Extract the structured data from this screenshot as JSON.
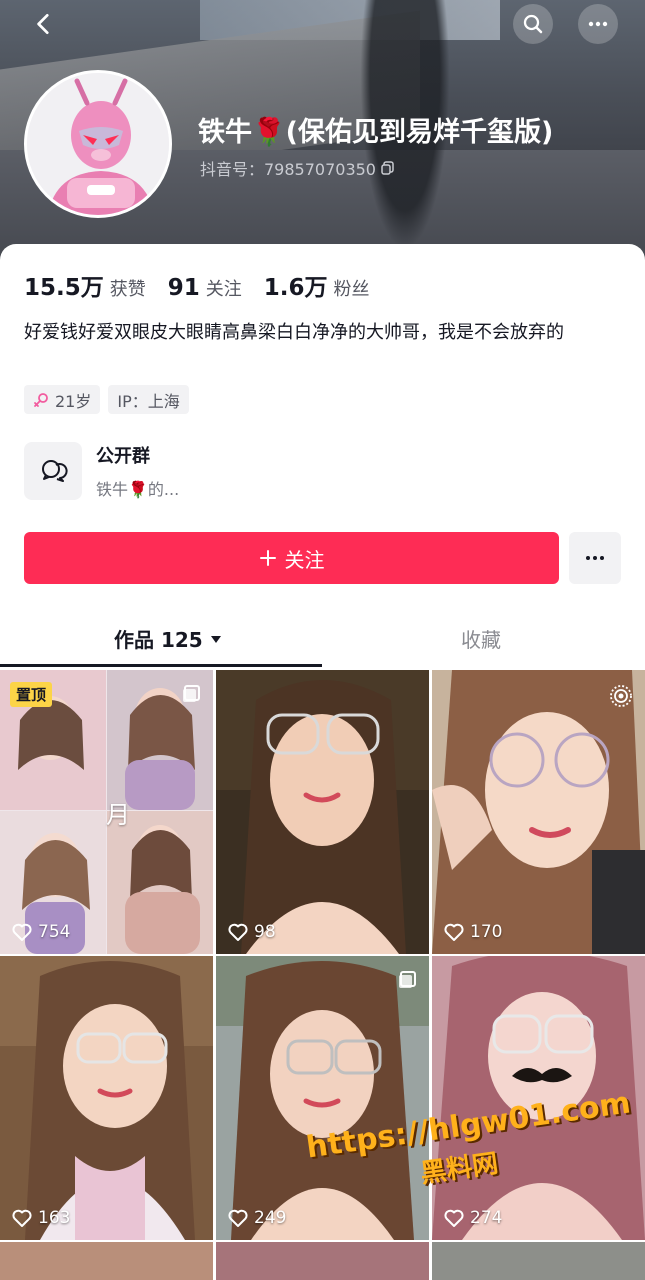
{
  "header": {
    "nickname": "铁牛🌹(保佑见到易烊千玺版)",
    "douyin_id": "抖音号：79857070350"
  },
  "stats": {
    "likes_num": "15.5万",
    "likes_label": "获赞",
    "following_num": "91",
    "following_label": "关注",
    "followers_num": "1.6万",
    "followers_label": "粉丝"
  },
  "bio": "好爱钱好爱双眼皮大眼睛高鼻梁白白净净的大帅哥，我是不会放弃的",
  "tags": {
    "age": "21岁",
    "ip": "IP：上海"
  },
  "group": {
    "title": "公开群",
    "subtitle": "铁牛🌹的..."
  },
  "actions": {
    "follow_label": "关注"
  },
  "tabs": {
    "works_label": "作品 125",
    "favorites_label": "收藏"
  },
  "videos": [
    {
      "likes": "754",
      "pinned_label": "置顶",
      "caption": "月"
    },
    {
      "likes": "98"
    },
    {
      "likes": "170"
    },
    {
      "likes": "163"
    },
    {
      "likes": "249"
    },
    {
      "likes": "274"
    }
  ],
  "watermark": {
    "url": "https://hlgw01.com",
    "text": "黑料网"
  },
  "colors": {
    "accent": "#fe2c55",
    "pin_badge": "#fcd447"
  }
}
